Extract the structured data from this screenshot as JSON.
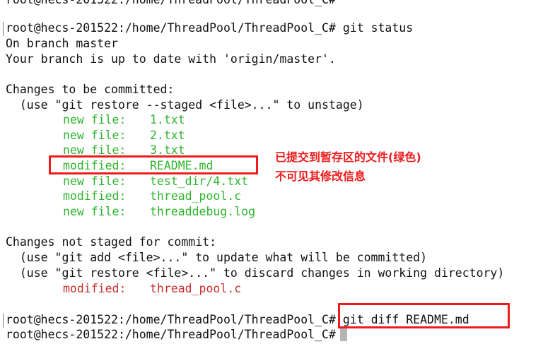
{
  "terminal": {
    "line0": "root@hecs-201522:/home/ThreadPool/ThreadPool_C#",
    "line1_prompt": "root@hecs-201522:/home/ThreadPool/ThreadPool_C#",
    "line1_cmd": "git status",
    "line2": "On branch master",
    "line3": "Your branch is up to date with 'origin/master'.",
    "line5": "Changes to be committed:",
    "line6": "  (use \"git restore --staged <file>...\" to unstage)",
    "staged": [
      {
        "status": "new file:",
        "file": "1.txt"
      },
      {
        "status": "new file:",
        "file": "2.txt"
      },
      {
        "status": "new file:",
        "file": "3.txt"
      },
      {
        "status": "modified:",
        "file": "README.md"
      },
      {
        "status": "new file:",
        "file": "test_dir/4.txt"
      },
      {
        "status": "modified:",
        "file": "thread_pool.c"
      },
      {
        "status": "new file:",
        "file": "threaddebug.log"
      }
    ],
    "line15": "Changes not staged for commit:",
    "line16": "  (use \"git add <file>...\" to update what will be committed)",
    "line17": "  (use \"git restore <file>...\" to discard changes in working directory)",
    "unstaged": [
      {
        "status": "modified:",
        "file": "thread_pool.c"
      }
    ],
    "line20_prompt": "root@hecs-201522:/home/ThreadPool/ThreadPool_C#",
    "line20_cmd": "git diff README.md",
    "line21_prompt": "root@hecs-201522:/home/ThreadPool/ThreadPool_C#"
  },
  "annotation": {
    "line1": "已提交到暂存区的文件(绿色)",
    "line2": "不可见其修改信息"
  },
  "colors": {
    "staged": "#2db52d",
    "unstaged": "#c9302c",
    "highlight": "#ef1b1b"
  }
}
